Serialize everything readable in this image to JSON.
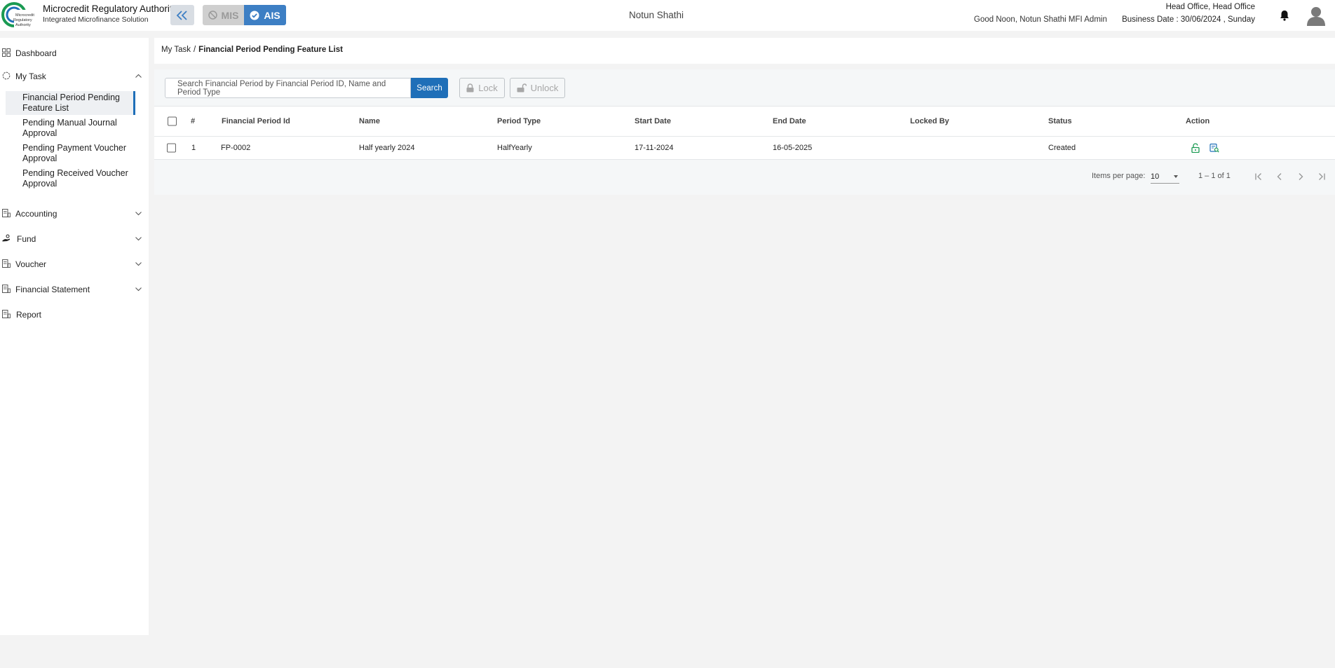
{
  "header": {
    "brand_title": "Microcredit Regulatory Authority",
    "brand_subtitle": "Integrated Microfinance Solution",
    "logo_text": [
      "Microcredit",
      "Regulatory",
      "Authority"
    ],
    "mode_mis": "MIS",
    "mode_ais": "AIS",
    "org_name": "Notun Shathi",
    "greeting": "Good Noon, Notun Shathi MFI Admin",
    "office": "Head Office, Head Office",
    "business_date": "Business Date : 30/06/2024 , Sunday",
    "colors": {
      "primary": "#1f6fb8",
      "ais_active": "#3d7fc4",
      "logo_green": "#1a9a52"
    }
  },
  "sidebar": {
    "dashboard": "Dashboard",
    "my_task": "My Task",
    "sub_items": [
      "Financial Period Pending Feature List",
      "Pending Manual Journal Approval",
      "Pending Payment Voucher Approval",
      "Pending Received Voucher Approval"
    ],
    "accounting": "Accounting",
    "fund": "Fund",
    "voucher": "Voucher",
    "financial_statement": "Financial Statement",
    "report": "Report"
  },
  "breadcrumb": {
    "parent": "My Task",
    "separator": "/",
    "current": "Financial Period Pending Feature List"
  },
  "toolbar": {
    "search_placeholder": "Search Financial Period by Financial Period ID, Name and Period Type",
    "search_label": "Search",
    "lock_label": "Lock",
    "unlock_label": "Unlock"
  },
  "table": {
    "columns": [
      "#",
      "Financial Period Id",
      "Name",
      "Period Type",
      "Start Date",
      "End Date",
      "Locked By",
      "Status",
      "Action"
    ],
    "rows": [
      {
        "index": "1",
        "id": "FP-0002",
        "name": "Half yearly 2024",
        "period_type": "HalfYearly",
        "start_date": "17-11-2024",
        "end_date": "16-05-2025",
        "locked_by": "",
        "status": "Created"
      }
    ]
  },
  "paginator": {
    "items_per_page_label": "Items per page:",
    "items_per_page": "10",
    "range": "1 – 1 of 1"
  }
}
